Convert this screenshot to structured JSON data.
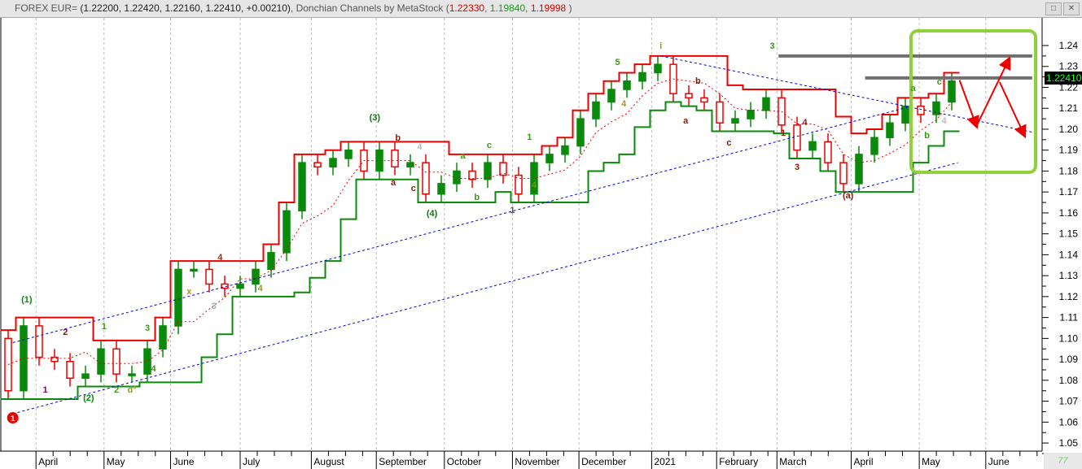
{
  "window": {
    "title_prefix": "FOREX EUR=",
    "ohlc": "(1.22200, 1.22420, 1.22160, 1.22410, +0.00210)",
    "indicator": "Donchian Channels by MetaStock",
    "ind_open": "(",
    "ind_upper": "1.22330",
    "ind_lower": "1.19840",
    "ind_mid": "1.19998",
    "ind_close": ")",
    "restore_icon": "□",
    "close_icon": "✕",
    "corner_label": "77"
  },
  "chart_data": {
    "type": "candlestick",
    "title": "FOREX EUR= Donchian Channels by MetaStock",
    "last_price": "1.22410",
    "ylim": [
      1.045,
      1.245
    ],
    "yticks": [
      1.05,
      1.06,
      1.07,
      1.08,
      1.09,
      1.1,
      1.11,
      1.12,
      1.13,
      1.14,
      1.15,
      1.16,
      1.17,
      1.18,
      1.19,
      1.2,
      1.21,
      1.22,
      1.23,
      1.24
    ],
    "x_unit": "week index",
    "months": [
      {
        "label": "April",
        "w": 1.8
      },
      {
        "label": "May",
        "w": 6.2
      },
      {
        "label": "June",
        "w": 10.5
      },
      {
        "label": "July",
        "w": 15.0
      },
      {
        "label": "August",
        "w": 19.6
      },
      {
        "label": "September",
        "w": 23.8
      },
      {
        "label": "October",
        "w": 28.2
      },
      {
        "label": "November",
        "w": 32.6
      },
      {
        "label": "December",
        "w": 36.9
      },
      {
        "label": "2021",
        "w": 41.6
      },
      {
        "label": "February",
        "w": 45.8
      },
      {
        "label": "March",
        "w": 49.7
      },
      {
        "label": "April",
        "w": 54.5
      },
      {
        "label": "May",
        "w": 58.9
      },
      {
        "label": "June",
        "w": 63.2
      }
    ],
    "start_price": 1.1,
    "closes": [
      1.075,
      1.106,
      1.091,
      1.089,
      1.081,
      1.083,
      1.095,
      1.083,
      1.083,
      1.095,
      1.106,
      1.133,
      1.133,
      1.126,
      1.124,
      1.126,
      1.133,
      1.141,
      1.161,
      1.184,
      1.182,
      1.186,
      1.19,
      1.18,
      1.19,
      1.182,
      1.184,
      1.169,
      1.174,
      1.18,
      1.176,
      1.184,
      1.178,
      1.169,
      1.184,
      1.188,
      1.192,
      1.205,
      1.213,
      1.219,
      1.223,
      1.227,
      1.231,
      1.217,
      1.215,
      1.213,
      1.203,
      1.205,
      1.209,
      1.215,
      1.202,
      1.19,
      1.194,
      1.184,
      1.174,
      1.188,
      1.196,
      1.203,
      1.211,
      1.207,
      1.213,
      1.223
    ],
    "donchian_period_weeks": 4,
    "trendlines": [
      {
        "w": [
          0.3,
          58.4
        ],
        "p": [
          1.098,
          1.211
        ]
      },
      {
        "w": [
          0.3,
          61.4
        ],
        "p": [
          1.064,
          1.184
        ]
      },
      {
        "w": [
          42.2,
          66.6
        ],
        "p": [
          1.235,
          1.198
        ]
      }
    ],
    "horizontal_levels": [
      {
        "p": 1.235,
        "w": [
          49.8,
          66.2
        ]
      },
      {
        "p": 1.2245,
        "w": [
          55.4,
          66.2
        ]
      }
    ],
    "projection": [
      {
        "w": 61.5,
        "p": 1.2235
      },
      {
        "w": 62.6,
        "p": 1.2015
      },
      {
        "w": 64.7,
        "p": 1.2335
      }
    ],
    "projection2": [
      {
        "w": 64.1,
        "p": 1.2225
      },
      {
        "w": 65.7,
        "p": 1.197
      }
    ],
    "labels": [
      {
        "t": "1",
        "w": 0.3,
        "p": 1.0605,
        "c": "#fff",
        "circle": true
      },
      {
        "t": "(1)",
        "w": 1.2,
        "p": 1.1172,
        "c": "#0a8a0a"
      },
      {
        "t": "1",
        "w": 2.4,
        "p": 1.0741,
        "c": "#8a0a5a"
      },
      {
        "t": "2",
        "w": 3.7,
        "p": 1.1017,
        "c": "#8a0a1a"
      },
      {
        "t": "(2)",
        "w": 5.2,
        "p": 1.0702,
        "c": "#0a8a0a"
      },
      {
        "t": "1",
        "w": 6.2,
        "p": 1.1044,
        "c": "#3a9a1a"
      },
      {
        "t": "2",
        "w": 7.0,
        "p": 1.0741,
        "c": "#3a9a1a"
      },
      {
        "t": "d°",
        "w": 8.0,
        "p": 1.0741,
        "c": "#8aa01a"
      },
      {
        "t": "3",
        "w": 9.0,
        "p": 1.1036,
        "c": "#3a9a1a"
      },
      {
        "t": "4",
        "w": 9.4,
        "p": 1.0842,
        "c": "#3a9a1a"
      },
      {
        "t": "x",
        "w": 11.7,
        "p": 1.1211,
        "c": "#9a9a1a"
      },
      {
        "t": "3",
        "w": 13.3,
        "p": 1.1141,
        "c": "#aaa"
      },
      {
        "t": "4",
        "w": 13.7,
        "p": 1.1374,
        "c": "#aa2a0a"
      },
      {
        "t": "4",
        "w": 16.3,
        "p": 1.1227,
        "c": "#9a9a1a"
      },
      {
        "t": "(3)",
        "w": 23.7,
        "p": 1.2043,
        "c": "#0a7a0a"
      },
      {
        "t": "b",
        "w": 25.2,
        "p": 1.1945,
        "c": "#8a1a0a"
      },
      {
        "t": "4",
        "w": 26.6,
        "p": 1.1903,
        "c": "#bbb"
      },
      {
        "t": "a",
        "w": 24.9,
        "p": 1.1732,
        "c": "#8a1a0a"
      },
      {
        "t": "c",
        "w": 26.2,
        "p": 1.1705,
        "c": "#8a1a0a"
      },
      {
        "t": "a",
        "w": 29.4,
        "p": 1.186,
        "c": "#3a9a1a"
      },
      {
        "t": "(4)",
        "w": 27.4,
        "p": 1.1584,
        "c": "#0a7a0a"
      },
      {
        "t": "b",
        "w": 30.3,
        "p": 1.1662,
        "c": "#3a9a1a"
      },
      {
        "t": "c",
        "w": 31.1,
        "p": 1.191,
        "c": "#3a9a1a"
      },
      {
        "t": "1",
        "w": 33.7,
        "p": 1.1949,
        "c": "#3a9a1a"
      },
      {
        "t": "1",
        "w": 32.6,
        "p": 1.16,
        "c": "#555"
      },
      {
        "t": "4",
        "w": 34.0,
        "p": 1.172,
        "c": "#6a9a1a"
      },
      {
        "t": "5",
        "w": 39.4,
        "p": 1.2307,
        "c": "#3a9a1a"
      },
      {
        "t": "4",
        "w": 39.8,
        "p": 1.2109,
        "c": "#9a9a1a"
      },
      {
        "t": "i",
        "w": 42.2,
        "p": 1.2384,
        "c": "#9a9a1a"
      },
      {
        "t": "b",
        "w": 44.6,
        "p": 1.2217,
        "c": "#8a1a0a"
      },
      {
        "t": "a",
        "w": 43.8,
        "p": 1.2027,
        "c": "#8a1a0a"
      },
      {
        "t": "c",
        "w": 46.6,
        "p": 1.1922,
        "c": "#8a1a0a"
      },
      {
        "t": "3",
        "w": 49.4,
        "p": 1.2384,
        "c": "#3a9a1a"
      },
      {
        "t": "1",
        "w": 50.1,
        "p": 1.1969,
        "c": "#8a1a0a"
      },
      {
        "t": "4",
        "w": 51.5,
        "p": 1.2019,
        "c": "#8a1a0a"
      },
      {
        "t": "3",
        "w": 51.0,
        "p": 1.1806,
        "c": "#8a1a0a"
      },
      {
        "t": "(a)",
        "w": 54.3,
        "p": 1.167,
        "c": "#8a1a0a"
      },
      {
        "t": "a",
        "w": 58.5,
        "p": 1.2182,
        "c": "#3a9a1a"
      },
      {
        "t": "c",
        "w": 60.2,
        "p": 1.2213,
        "c": "#3a9a1a"
      },
      {
        "t": "b",
        "w": 59.4,
        "p": 1.1957,
        "c": "#3a9a1a"
      },
      {
        "t": "4",
        "w": 60.5,
        "p": 1.2027,
        "c": "#bbb"
      }
    ],
    "colors": {
      "upper": "#ee0000",
      "lower": "#0a8a0a",
      "mid": "#ee0000",
      "trend": "#0000dd",
      "level": "#707070",
      "box": "#8ed13a",
      "arrow": "#ee0000",
      "up": "#0a8a0a",
      "down": "#ee0000"
    }
  }
}
